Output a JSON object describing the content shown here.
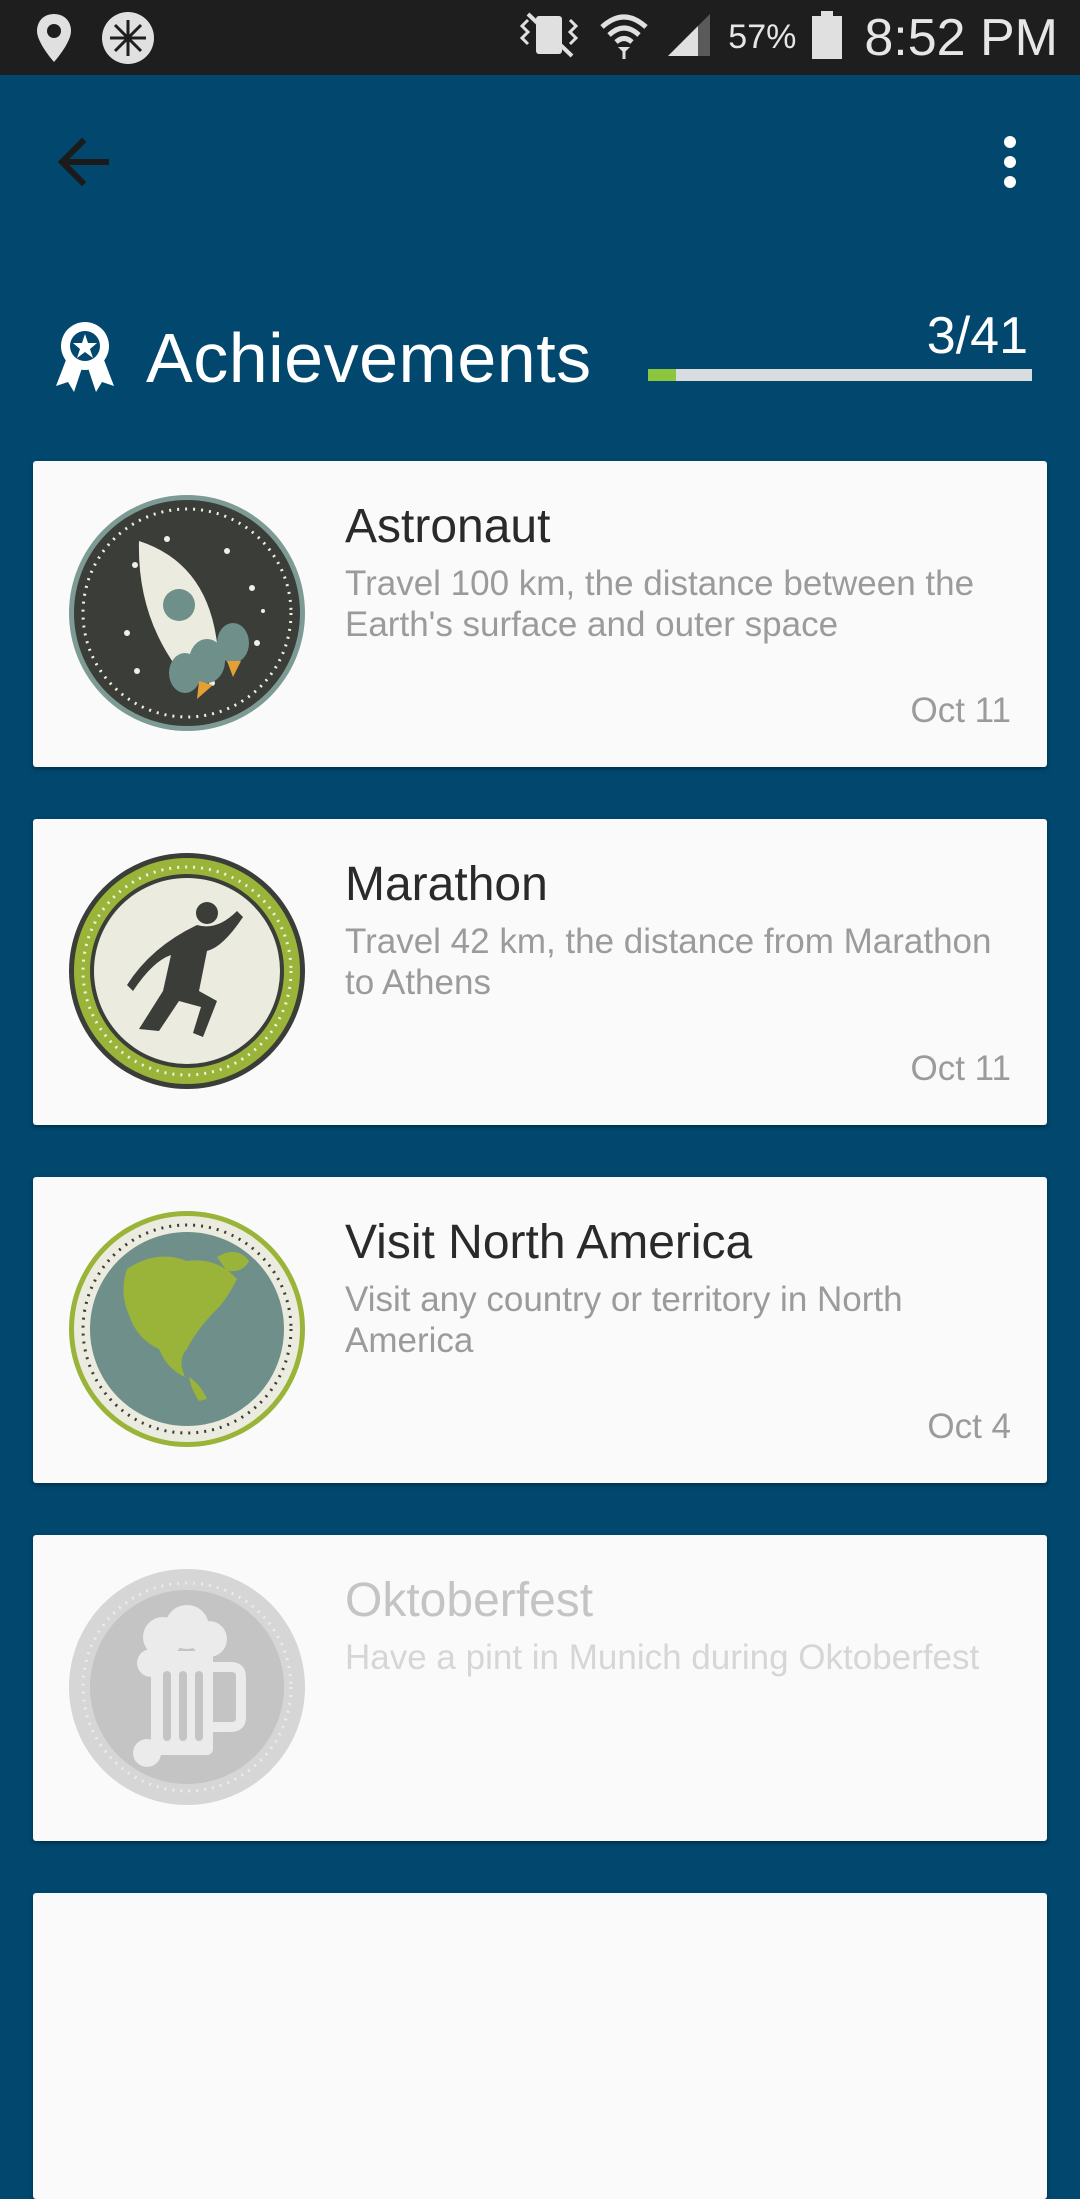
{
  "status_bar": {
    "battery_percent": "57%",
    "time": "8:52 PM",
    "icons": [
      "location-pin-icon",
      "compass-icon",
      "vibrate-icon",
      "wifi-icon",
      "signal-icon",
      "battery-icon"
    ]
  },
  "toolbar": {
    "back_icon": "arrow-left-icon",
    "menu_icon": "more-vert-icon"
  },
  "header": {
    "title": "Achievements",
    "icon": "award-ribbon-icon",
    "progress_text": "3/41",
    "progress_fraction": 0.0732
  },
  "colors": {
    "background": "#01476e",
    "progress_fill": "#8cc63f",
    "card": "#fafafa"
  },
  "achievements": [
    {
      "title": "Astronaut",
      "description": "Travel 100 km, the distance between the Earth's surface and outer space",
      "date": "Oct 11",
      "badge_icon": "rocket-icon",
      "unlocked": true
    },
    {
      "title": "Marathon",
      "description": "Travel 42 km, the distance from Marathon to Athens",
      "date": "Oct 11",
      "badge_icon": "runner-icon",
      "unlocked": true
    },
    {
      "title": "Visit North America",
      "description": "Visit any country or territory in North America",
      "date": "Oct 4",
      "badge_icon": "globe-north-america-icon",
      "unlocked": true
    },
    {
      "title": "Oktoberfest",
      "description": "Have a pint in Munich during Oktoberfest",
      "date": "",
      "badge_icon": "beer-mug-icon",
      "unlocked": false
    }
  ]
}
